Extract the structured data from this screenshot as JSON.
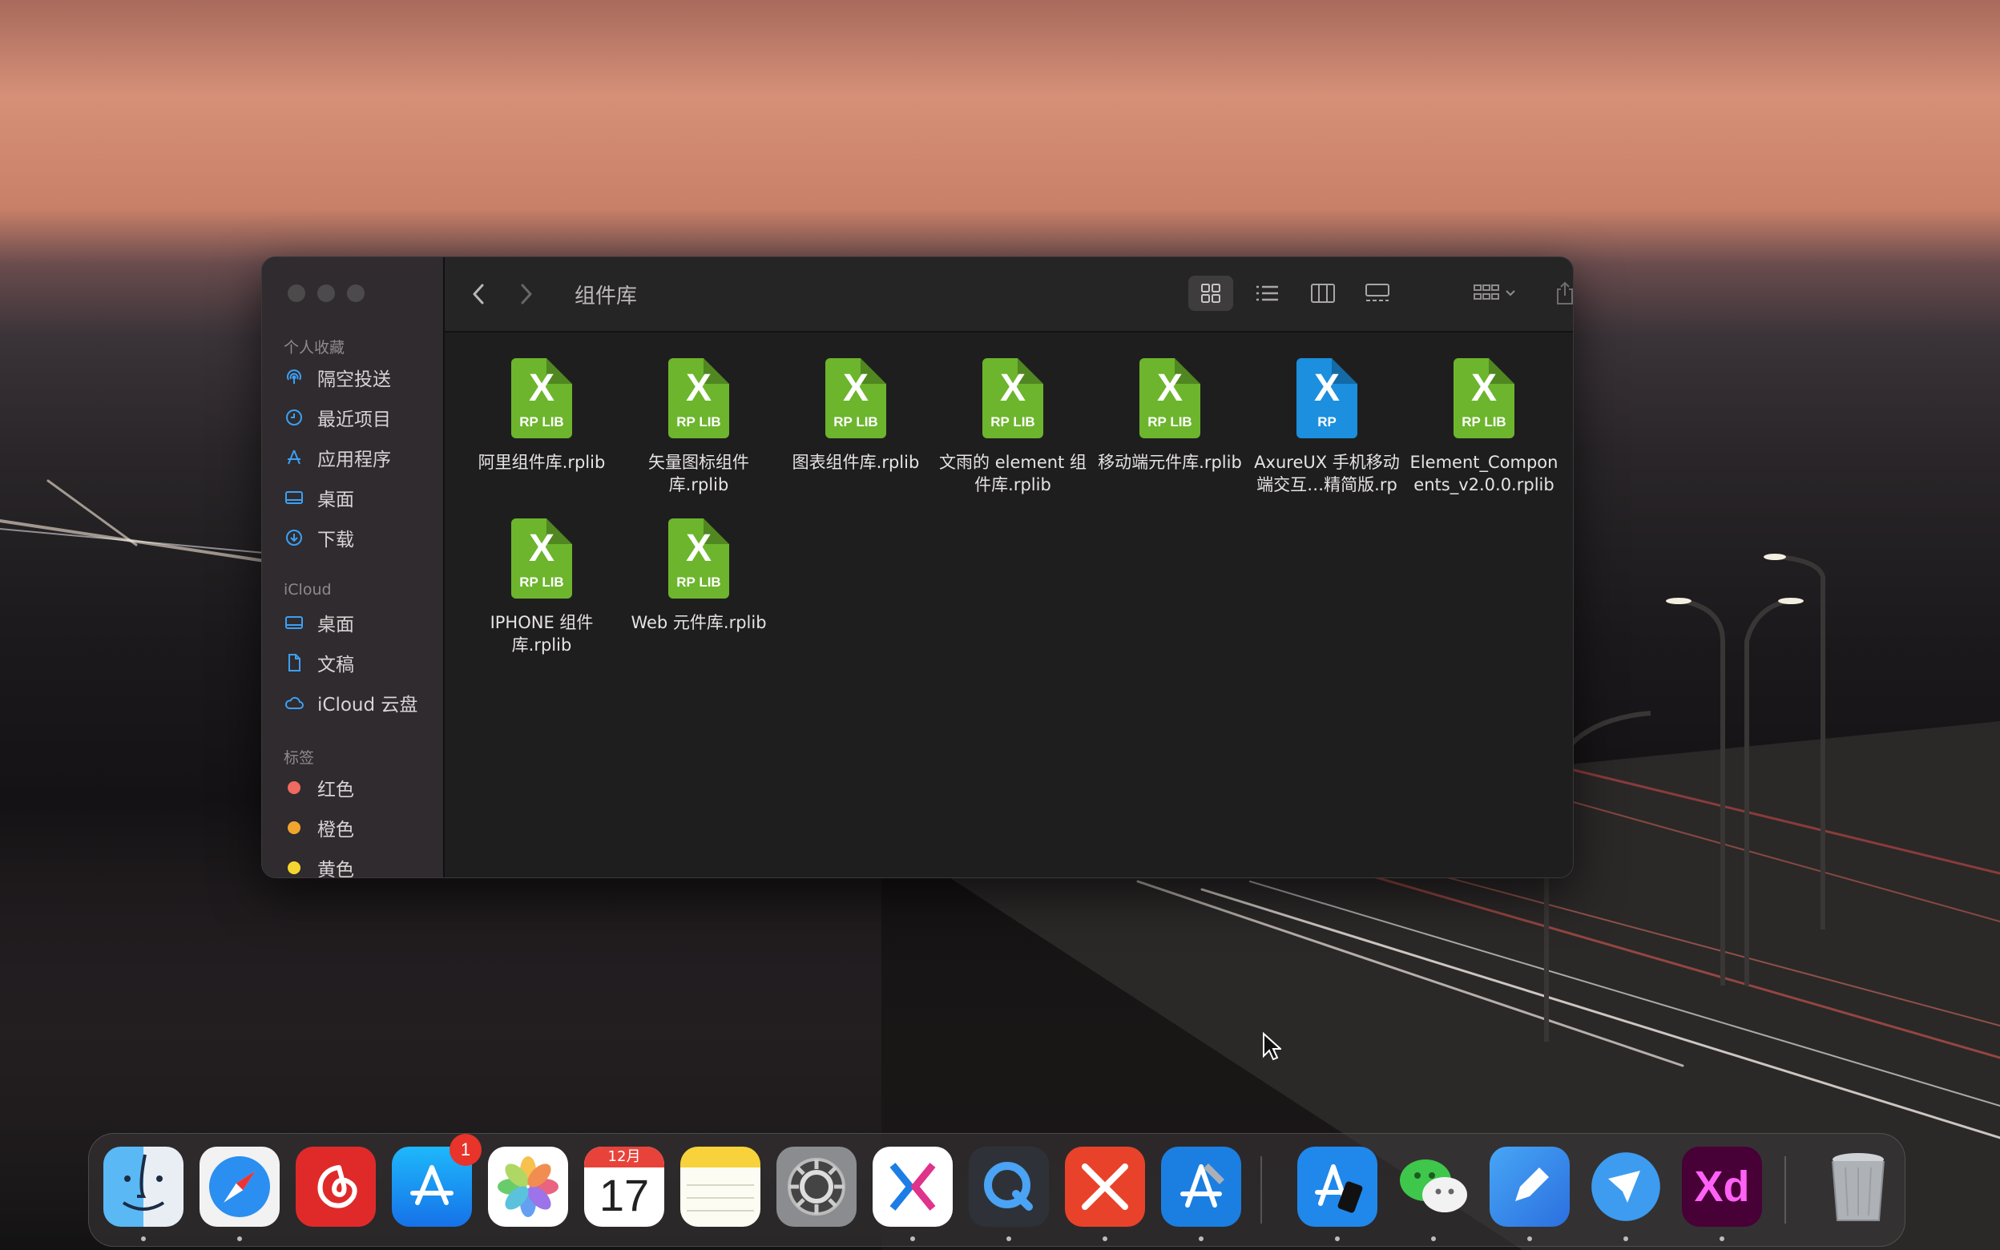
{
  "finder": {
    "title": "组件库",
    "sidebar": {
      "favorites_header": "个人收藏",
      "favorites": [
        {
          "label": "隔空投送",
          "icon": "airdrop-icon"
        },
        {
          "label": "最近项目",
          "icon": "clock-icon"
        },
        {
          "label": "应用程序",
          "icon": "applications-icon"
        },
        {
          "label": "桌面",
          "icon": "desktop-icon"
        },
        {
          "label": "下载",
          "icon": "download-icon"
        }
      ],
      "icloud_header": "iCloud",
      "icloud": [
        {
          "label": "桌面",
          "icon": "desktop-icon"
        },
        {
          "label": "文稿",
          "icon": "document-icon"
        },
        {
          "label": "iCloud 云盘",
          "icon": "cloud-icon"
        }
      ],
      "tags_header": "标签",
      "tags": [
        {
          "label": "红色",
          "color": "#ef6a60"
        },
        {
          "label": "橙色",
          "color": "#f0a52f"
        },
        {
          "label": "黄色",
          "color": "#f5d630"
        }
      ]
    },
    "files": [
      {
        "name_line1": "阿里组件库.rplib",
        "name_line2": "",
        "badge": "RP LIB",
        "color": "#6cb52d"
      },
      {
        "name_line1": "矢量图标组件",
        "name_line2": "库.rplib",
        "badge": "RP LIB",
        "color": "#6cb52d"
      },
      {
        "name_line1": "图表组件库.rplib",
        "name_line2": "",
        "badge": "RP LIB",
        "color": "#6cb52d"
      },
      {
        "name_line1": "文雨的 element 组",
        "name_line2": "件库.rplib",
        "badge": "RP LIB",
        "color": "#6cb52d"
      },
      {
        "name_line1": "移动端元件库.rplib",
        "name_line2": "",
        "badge": "RP LIB",
        "color": "#6cb52d"
      },
      {
        "name_line1": "AxureUX 手机移动",
        "name_line2": "端交互…精简版.rp",
        "badge": "RP",
        "color": "#1c8fde"
      },
      {
        "name_line1": "Element_Compon",
        "name_line2": "ents_v2.0.0.rplib",
        "badge": "RP LIB",
        "color": "#6cb52d"
      },
      {
        "name_line1": "IPHONE 组件",
        "name_line2": "库.rplib",
        "badge": "RP LIB",
        "color": "#6cb52d"
      },
      {
        "name_line1": "Web 元件库.rplib",
        "name_line2": "",
        "badge": "RP LIB",
        "color": "#6cb52d"
      }
    ]
  },
  "dock": {
    "apps": [
      {
        "name": "Finder",
        "icon": "finder-icon",
        "running": true
      },
      {
        "name": "Safari",
        "icon": "safari-icon",
        "running": true
      },
      {
        "name": "NetEase Music",
        "icon": "netease-music-icon",
        "running": false
      },
      {
        "name": "App Store",
        "icon": "app-store-icon",
        "running": false,
        "badge": "1"
      },
      {
        "name": "Photos",
        "icon": "photos-icon",
        "running": false
      },
      {
        "name": "Calendar",
        "icon": "calendar-icon",
        "running": false,
        "month": "12月",
        "day": "17"
      },
      {
        "name": "Notes",
        "icon": "notes-icon",
        "running": false
      },
      {
        "name": "System Preferences",
        "icon": "system-preferences-icon",
        "running": false
      },
      {
        "name": "Axure RP",
        "icon": "axure-icon",
        "running": true
      },
      {
        "name": "QuickTime Player",
        "icon": "quicktime-icon",
        "running": true
      },
      {
        "name": "XMind",
        "icon": "xmind-icon",
        "running": true
      },
      {
        "name": "Xcode",
        "icon": "xcode-icon",
        "running": true
      },
      {
        "name": "Simulator",
        "icon": "simulator-icon",
        "running": true
      },
      {
        "name": "WeChat",
        "icon": "wechat-icon",
        "running": true
      },
      {
        "name": "Pages",
        "icon": "pen-icon",
        "running": true
      },
      {
        "name": "Feishu",
        "icon": "feishu-icon",
        "running": true
      },
      {
        "name": "Adobe XD",
        "icon": "adobe-xd-icon",
        "running": true,
        "label": "Xd"
      },
      {
        "name": "Trash",
        "icon": "trash-icon",
        "running": false
      }
    ]
  }
}
